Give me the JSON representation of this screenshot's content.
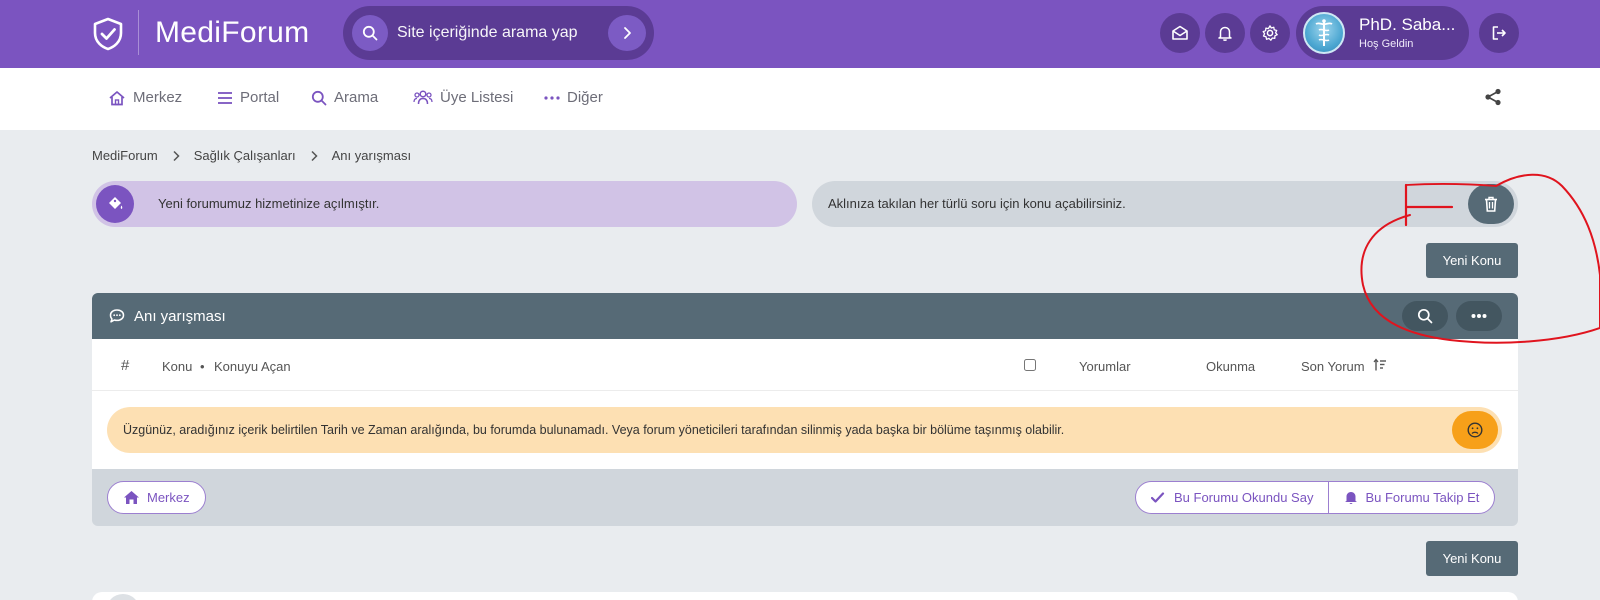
{
  "brand": {
    "name": "MediForum"
  },
  "search": {
    "placeholder": "Site içeriğinde arama yap"
  },
  "user": {
    "name": "PhD. Saba...",
    "greeting": "Hoş Geldin"
  },
  "nav": {
    "items": [
      {
        "label": "Merkez",
        "icon": "home-icon"
      },
      {
        "label": "Portal",
        "icon": "list-icon"
      },
      {
        "label": "Arama",
        "icon": "search-icon"
      },
      {
        "label": "Üye Listesi",
        "icon": "users-icon"
      },
      {
        "label": "Diğer",
        "icon": "more-icon"
      }
    ]
  },
  "breadcrumb": [
    "MediForum",
    "Sağlık Çalışanları",
    "Anı yarışması"
  ],
  "notices": {
    "left": "Yeni forumumuz hizmetinize açılmıştır.",
    "right": "Aklınıza takılan her türlü soru için konu açabilirsiniz."
  },
  "actions": {
    "new_topic": "Yeni Konu"
  },
  "forum": {
    "title": "Anı yarışması",
    "columns": {
      "hash": "#",
      "topic": "Konu",
      "dot": "•",
      "author": "Konuyu Açan",
      "comments": "Yorumlar",
      "views": "Okunma",
      "last": "Son Yorum"
    },
    "empty_message": "Üzgünüz, aradığınız içerik belirtilen Tarih ve Zaman aralığında, bu forumda bulunamadı. Veya forum yöneticileri tarafından silinmiş yada başka bir bölüme taşınmış olabilir.",
    "footer": {
      "home": "Merkez",
      "mark_read": "Bu Forumu Okundu Say",
      "follow": "Bu Forumu Takip Et"
    }
  },
  "colors": {
    "primary": "#7b54c0",
    "primary_dark": "#5b3b94",
    "slate": "#566a76",
    "warning": "#f7a019",
    "annotation": "#e0141e"
  }
}
